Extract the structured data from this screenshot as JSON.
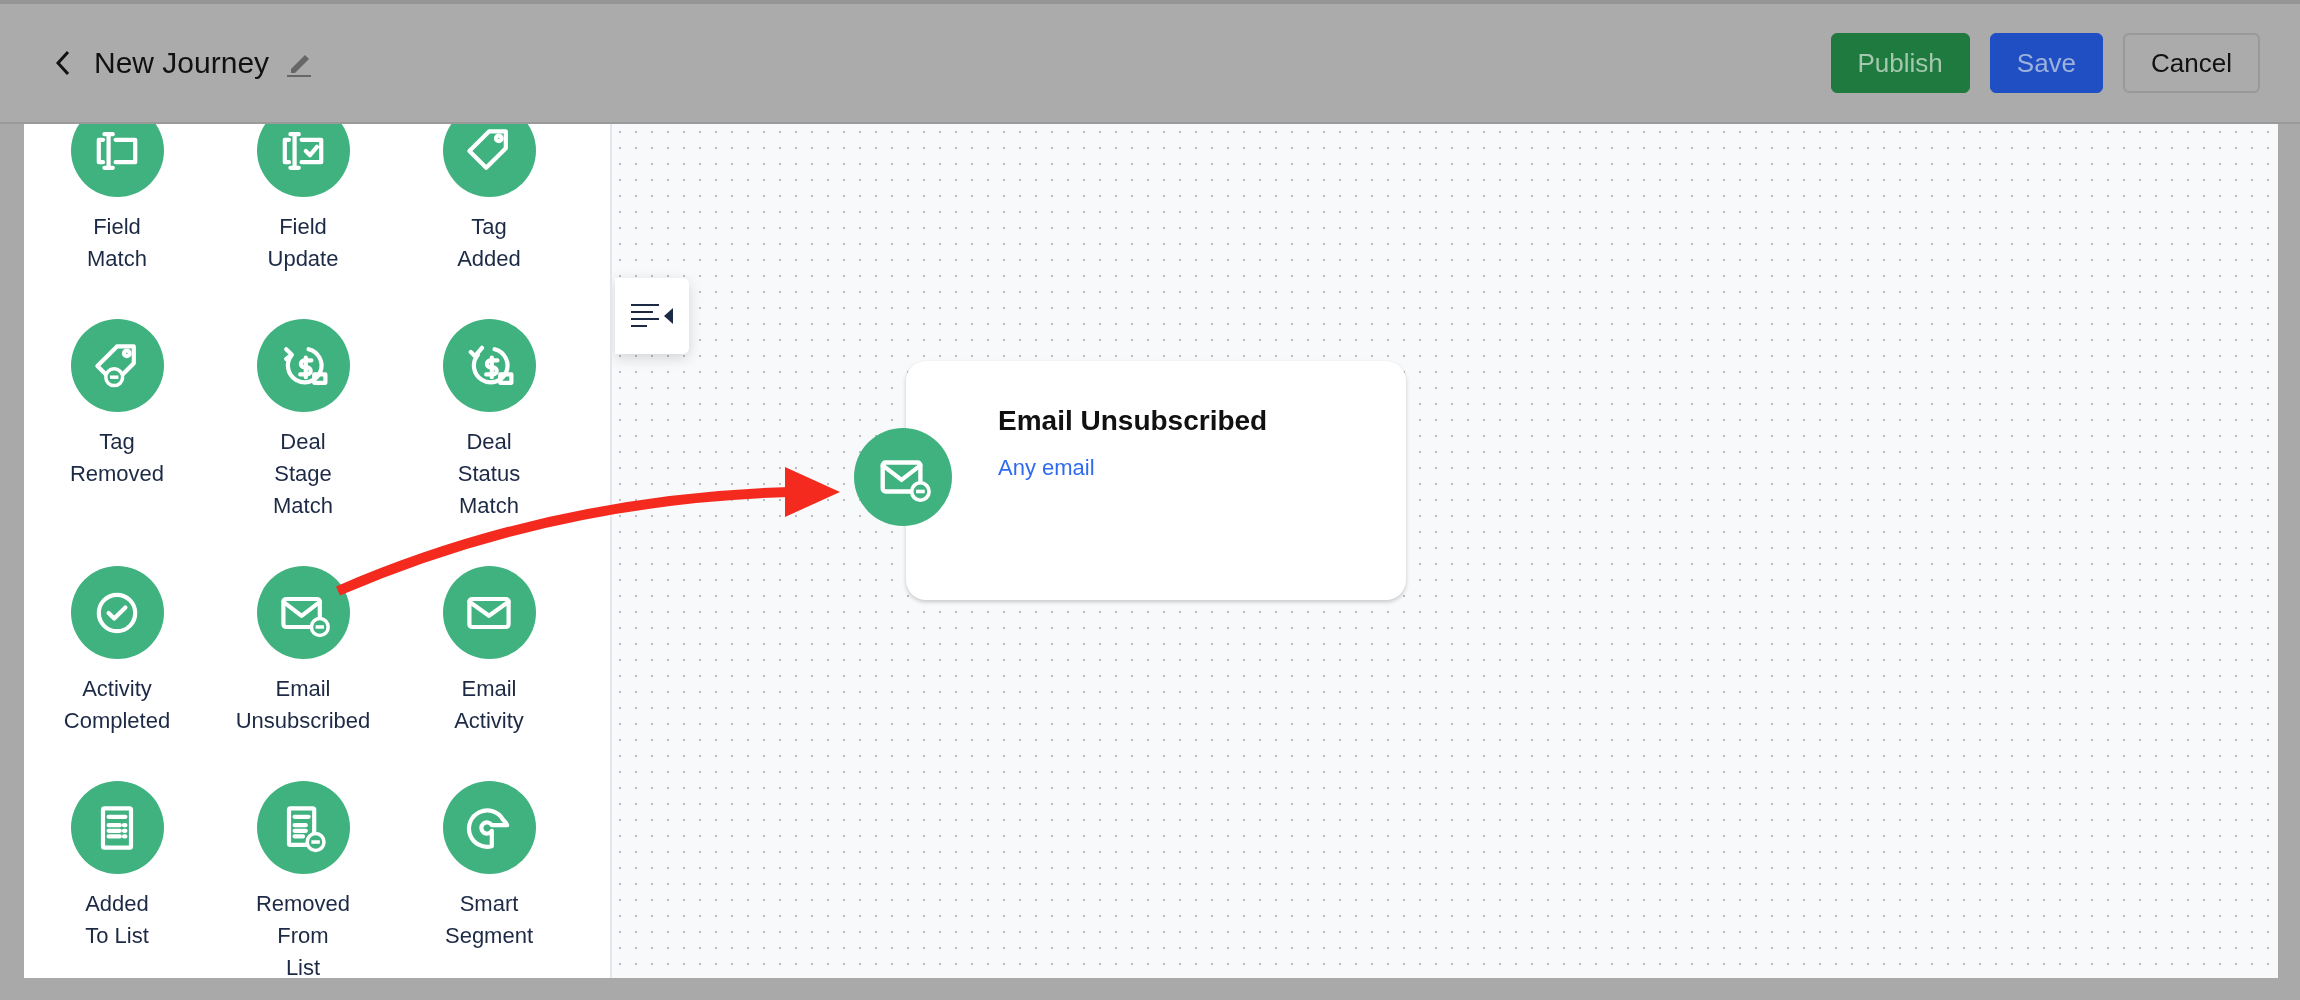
{
  "header": {
    "title": "New Journey",
    "buttons": [
      {
        "label": "Publish",
        "kind": "publish"
      },
      {
        "label": "Save",
        "kind": "save"
      },
      {
        "label": "Cancel",
        "kind": "cancel"
      }
    ]
  },
  "palette": {
    "items": [
      {
        "label": "Field\nMatch",
        "kind": "fieldmatch"
      },
      {
        "label": "Field\nUpdate",
        "kind": "fieldupdate"
      },
      {
        "label": "Tag\nAdded",
        "kind": "tag"
      },
      {
        "label": "Tag\nRemoved",
        "kind": "untag"
      },
      {
        "label": "Deal\nStage\nMatch",
        "kind": "dealstage"
      },
      {
        "label": "Deal\nStatus\nMatch",
        "kind": "dealstatus"
      },
      {
        "label": "Activity\nCompleted",
        "kind": "activity"
      },
      {
        "label": "Email\nUnsubscribed",
        "kind": "unsubscribe"
      },
      {
        "label": "Email\nActivity",
        "kind": "email"
      },
      {
        "label": "Added\nTo List",
        "kind": "list"
      },
      {
        "label": "Removed\nFrom\nList",
        "kind": "unlist"
      },
      {
        "label": "Smart\nSegment",
        "kind": "segment"
      }
    ]
  },
  "node": {
    "title": "Email Unsubscribed",
    "subtitle": "Any email",
    "kind": "unsubscribe"
  }
}
